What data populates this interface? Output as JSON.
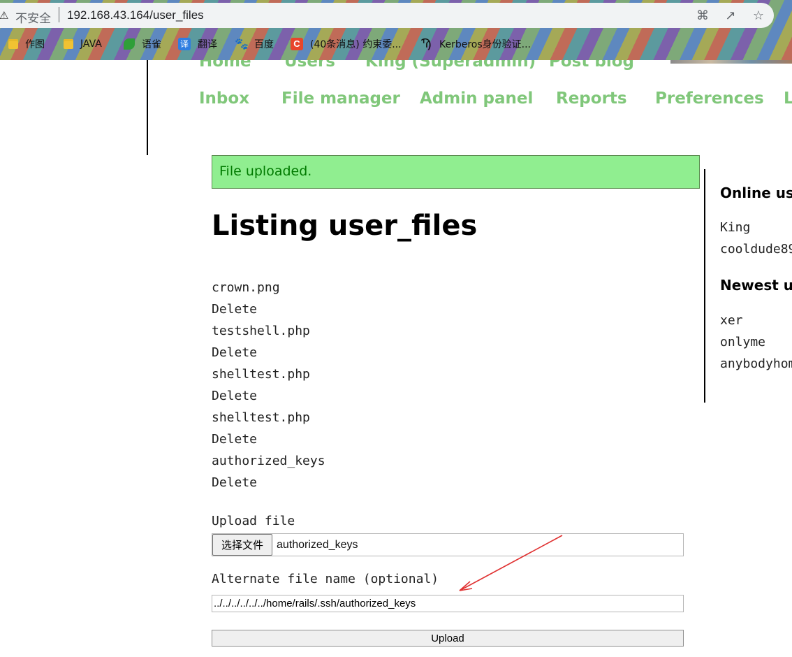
{
  "browser": {
    "security_label": "不安全",
    "url": "192.168.43.164/user_files",
    "bookmarks": [
      {
        "label": "作图",
        "icon": "folder-icon"
      },
      {
        "label": "JAVA",
        "icon": "folder-icon"
      },
      {
        "label": "语雀",
        "icon": "leaf-icon"
      },
      {
        "label": "翻译",
        "icon": "translate-icon"
      },
      {
        "label": "百度",
        "icon": "baidu-paw-icon"
      },
      {
        "label": "(40条消息) 约束委...",
        "icon": "csdn-c-icon"
      },
      {
        "label": "Kerberos身份验证...",
        "icon": "k-logo-icon"
      }
    ],
    "toolbar_icons": [
      "translate-icon",
      "share-icon",
      "star-icon"
    ]
  },
  "nav": {
    "top_row": [
      "Home",
      "Users",
      "King (Superadmin)",
      "Post blog"
    ],
    "main_row": [
      "Inbox",
      "File manager",
      "Admin panel",
      "Reports",
      "Preferences",
      "L"
    ]
  },
  "flash": {
    "message": "File uploaded."
  },
  "page": {
    "title": "Listing user_files"
  },
  "files": [
    {
      "name": "crown.png",
      "action": "Delete"
    },
    {
      "name": "testshell.php",
      "action": "Delete"
    },
    {
      "name": "shelltest.php",
      "action": "Delete"
    },
    {
      "name": "shelltest.php",
      "action": "Delete"
    },
    {
      "name": "authorized_keys",
      "action": "Delete"
    }
  ],
  "upload": {
    "file_label": "Upload file",
    "choose_button": "选择文件",
    "chosen_file": "authorized_keys",
    "alternate_label": "Alternate file name (optional)",
    "alternate_value": "../../../../../../home/rails/.ssh/authorized_keys",
    "submit_label": "Upload"
  },
  "sidebar": {
    "online_heading": "Online use",
    "online_users": [
      "King",
      "cooldude89"
    ],
    "newest_heading": "Newest us",
    "newest_users": [
      "xer",
      "onlyme",
      "anybodyhome"
    ]
  },
  "colors": {
    "nav_green": "#80c77a",
    "flash_background": "#90ee90",
    "flash_text": "#007a00",
    "arrow_red": "#e03131"
  }
}
